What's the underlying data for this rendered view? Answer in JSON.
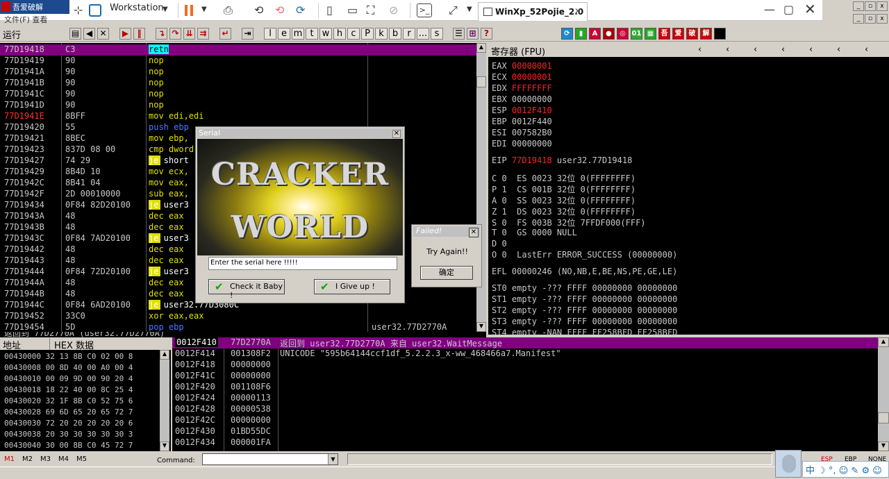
{
  "od_title": "吾爱破解",
  "od_menu": [
    "文件(F)",
    "查看"
  ],
  "vm": {
    "workstation": "Workstation",
    "tab": "WinXp_52Pojie_2.0",
    "close": "✕",
    "win_buttons": [
      "—",
      "▢",
      "✕"
    ]
  },
  "toolbar": {
    "run_label": "运行",
    "letters": [
      "l",
      "e",
      "m",
      "t",
      "w",
      "h",
      "c",
      "P",
      "k",
      "b",
      "r",
      "...",
      "s"
    ],
    "chinese": [
      "吾",
      "爱",
      "破",
      "解"
    ]
  },
  "disasm": [
    {
      "addr": "77D19418",
      "hex": "C3",
      "instr": "retn",
      "sel": true
    },
    {
      "addr": "77D19419",
      "hex": "90",
      "instr": "nop"
    },
    {
      "addr": "77D1941A",
      "hex": "90",
      "instr": "nop"
    },
    {
      "addr": "77D1941B",
      "hex": "90",
      "instr": "nop"
    },
    {
      "addr": "77D1941C",
      "hex": "90",
      "instr": "nop"
    },
    {
      "addr": "77D1941D",
      "hex": "90",
      "instr": "nop"
    },
    {
      "addr": "77D1941E",
      "hex": "8BFF",
      "instr": "mov edi,edi",
      "red": true
    },
    {
      "addr": "77D19420",
      "hex": "55",
      "instr": "push ebp"
    },
    {
      "addr": "77D19421",
      "hex": "8BEC",
      "instr": "mov ebp,"
    },
    {
      "addr": "77D19423",
      "hex": "837D 08 00",
      "instr": "cmp dword"
    },
    {
      "addr": "77D19427",
      "hex": "74 29",
      "instr": "je short"
    },
    {
      "addr": "77D19429",
      "hex": "8B4D 10",
      "instr": "mov ecx,"
    },
    {
      "addr": "77D1942C",
      "hex": "8B41 04",
      "instr": "mov eax,"
    },
    {
      "addr": "77D1942F",
      "hex": "2D 00010000",
      "instr": "sub eax,"
    },
    {
      "addr": "77D19434",
      "hex": "0F84 82D20100",
      "instr": "je user3"
    },
    {
      "addr": "77D1943A",
      "hex": "48",
      "instr": "dec eax"
    },
    {
      "addr": "77D1943B",
      "hex": "48",
      "instr": "dec eax"
    },
    {
      "addr": "77D1943C",
      "hex": "0F84 7AD20100",
      "instr": "je user3"
    },
    {
      "addr": "77D19442",
      "hex": "48",
      "instr": "dec eax"
    },
    {
      "addr": "77D19443",
      "hex": "48",
      "instr": "dec eax"
    },
    {
      "addr": "77D19444",
      "hex": "0F84 72D20100",
      "instr": "je user3"
    },
    {
      "addr": "77D1944A",
      "hex": "48",
      "instr": "dec eax"
    },
    {
      "addr": "77D1944B",
      "hex": "48",
      "instr": "dec eax"
    },
    {
      "addr": "77D1944C",
      "hex": "0F84 6AD20100",
      "instr": "je user32.77D3080C"
    },
    {
      "addr": "77D19452",
      "hex": "33C0",
      "instr": "xor eax,eax"
    },
    {
      "addr": "77D19454",
      "hex": "5D",
      "instr": "pop ebp",
      "comment": "user32.77D2770A"
    }
  ],
  "info_line": "返回到 77D2770A (user32.77D2770A)",
  "regs": {
    "title": "寄存器 (FPU)",
    "lines": [
      {
        "t": "EAX ",
        "v": "00000001",
        "red": true
      },
      {
        "t": "ECX ",
        "v": "00000001",
        "red": true
      },
      {
        "t": "EDX ",
        "v": "FFFFFFFF",
        "red": true
      },
      {
        "t": "EBX 00000000"
      },
      {
        "t": "ESP ",
        "v": "0012F410",
        "red": true
      },
      {
        "t": "EBP 0012F440"
      },
      {
        "t": "ESI 007582B0"
      },
      {
        "t": "EDI 00000000"
      },
      {
        "t": "",
        "gap": true
      },
      {
        "t": "EIP ",
        "v": "77D19418",
        "red": true,
        "rest": " user32.77D19418"
      },
      {
        "t": "",
        "gap": true
      },
      {
        "t": "C 0  ES 0023 32位 0(FFFFFFFF)"
      },
      {
        "t": "P 1  CS 001B 32位 0(FFFFFFFF)"
      },
      {
        "t": "A 0  SS 0023 32位 0(FFFFFFFF)"
      },
      {
        "t": "Z 1  DS 0023 32位 0(FFFFFFFF)"
      },
      {
        "t": "S 0  FS 003B 32位 7FFDF000(FFF)"
      },
      {
        "t": "T 0  GS 0000 NULL"
      },
      {
        "t": "D 0"
      },
      {
        "t": "O 0  LastErr ERROR_SUCCESS (00000000)"
      },
      {
        "t": "",
        "gap": true
      },
      {
        "t": "EFL 00000246 (NO,NB,E,BE,NS,PE,GE,LE)"
      },
      {
        "t": "",
        "gap": true
      },
      {
        "t": "ST0 empty -??? FFFF 00000000 00000000"
      },
      {
        "t": "ST1 empty -??? FFFF 00000000 00000000"
      },
      {
        "t": "ST2 empty -??? FFFF 00000000 00000000"
      },
      {
        "t": "ST3 empty -??? FFFF 00000000 00000000"
      },
      {
        "t": "ST4 empty -NAN FFFF FF258BFD FF258BFD"
      }
    ]
  },
  "dump": {
    "addr_header": "地址",
    "hex_header": "HEX 数据",
    "rows": [
      "00430000 32 13 8B C0 02 00 8",
      "00430008 00 8D 40 00 A0 00 4",
      "00430010 00 09 9D 00 90 20 4",
      "00430018 18 22 40 00 8C 25 4",
      "00430020 32 1F 8B C0 52 75 6",
      "00430028 69 6D 65 20 65 72 7",
      "00430030 72 20 20 20 20 20 6",
      "00430038 20 30 30 30 30 30 3",
      "00430040 30 00 8B C0 45 72 7"
    ]
  },
  "stack": [
    {
      "addr": "0012F410",
      "val": "77D2770A",
      "comment": "返回到 user32.77D2770A 来自 user32.WaitMessage",
      "sel": true
    },
    {
      "addr": "0012F414",
      "val": "001308F2",
      "comment": "UNICODE \"595b64144ccf1df_5.2.2.3_x-ww_468466a7.Manifest\""
    },
    {
      "addr": "0012F418",
      "val": "00000000"
    },
    {
      "addr": "0012F41C",
      "val": "00000000"
    },
    {
      "addr": "0012F420",
      "val": "001108F6"
    },
    {
      "addr": "0012F424",
      "val": "00000113"
    },
    {
      "addr": "0012F428",
      "val": "00000538"
    },
    {
      "addr": "0012F42C",
      "val": "00000000"
    },
    {
      "addr": "0012F430",
      "val": "01BD55DC"
    },
    {
      "addr": "0012F434",
      "val": "000001FA"
    }
  ],
  "cmd": {
    "tabs": [
      "M1",
      "M2",
      "M3",
      "M4",
      "M5"
    ],
    "label": "Command:"
  },
  "status": {
    "right": [
      "ESP",
      "EBP",
      "NONE"
    ]
  },
  "ime": [
    "中",
    "☽",
    "°,",
    "☺",
    "✎",
    "⚙",
    "☺"
  ],
  "serial": {
    "title": "Serial",
    "banner_top": "CRACKER",
    "banner_bottom": "WORLD",
    "input_value": "Enter the serial here !!!!!",
    "check_label": "Check it Baby !",
    "giveup_label": "I Give up !",
    "close": "✕"
  },
  "failed": {
    "title": "Failed!",
    "message": "Try Again!!",
    "ok": "确定",
    "close": "✕"
  }
}
